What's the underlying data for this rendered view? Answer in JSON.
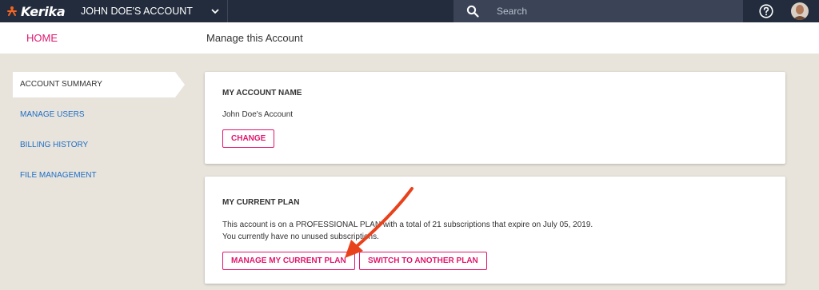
{
  "topbar": {
    "logo_text": "Kerika",
    "account_name": "JOHN DOE'S ACCOUNT",
    "search_placeholder": "Search"
  },
  "subheader": {
    "home_label": "HOME",
    "page_title": "Manage this Account"
  },
  "sidebar": {
    "items": [
      {
        "label": "ACCOUNT SUMMARY",
        "active": true
      },
      {
        "label": "MANAGE USERS",
        "active": false
      },
      {
        "label": "BILLING HISTORY",
        "active": false
      },
      {
        "label": "FILE MANAGEMENT",
        "active": false
      }
    ]
  },
  "account_name_card": {
    "title": "MY ACCOUNT NAME",
    "value": "John Doe's Account",
    "change_label": "CHANGE"
  },
  "plan_card": {
    "title": "MY CURRENT PLAN",
    "description_line1": "This account is on a PROFESSIONAL PLAN with a total of 21 subscriptions that expire on July 05, 2019.",
    "description_line2": "You currently have no unused subscriptions.",
    "manage_label": "MANAGE MY CURRENT PLAN",
    "switch_label": "SWITCH TO ANOTHER PLAN"
  },
  "colors": {
    "accent": "#e0176e",
    "topbar": "#222c3c",
    "link": "#1e6dc5",
    "arrow": "#e8421c",
    "background": "#e8e4dc"
  }
}
